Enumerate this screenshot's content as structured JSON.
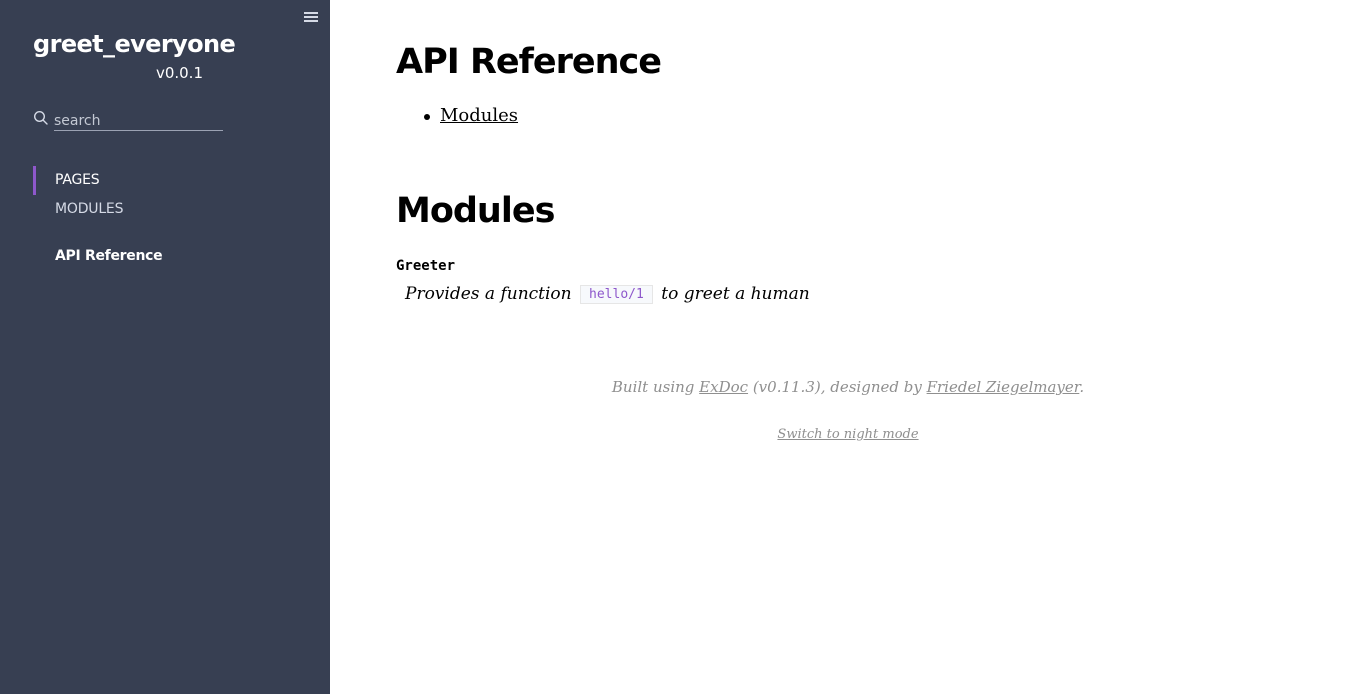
{
  "sidebar": {
    "project_name": "greet_everyone",
    "version": "v0.0.1",
    "search_placeholder": "search",
    "tabs": [
      {
        "label": "PAGES",
        "active": true
      },
      {
        "label": "MODULES",
        "active": false
      }
    ],
    "nav_items": [
      {
        "label": "API Reference"
      }
    ]
  },
  "content": {
    "title": "API Reference",
    "toc": [
      {
        "label": "Modules"
      }
    ],
    "modules_heading": "Modules",
    "modules": [
      {
        "name": "Greeter",
        "summary_before": "Provides a function",
        "summary_code": "hello/1",
        "summary_after": "to greet a human"
      }
    ]
  },
  "footer": {
    "built_prefix": "Built using",
    "exdoc_link": "ExDoc",
    "built_middle": "(v0.11.3), designed by",
    "designer_link": "Friedel Ziegelmayer",
    "built_suffix": ".",
    "night_mode": "Switch to night mode"
  },
  "colors": {
    "sidebar_bg": "#373f52",
    "accent": "#8e58cb",
    "footer_text": "#8f8f8f"
  }
}
